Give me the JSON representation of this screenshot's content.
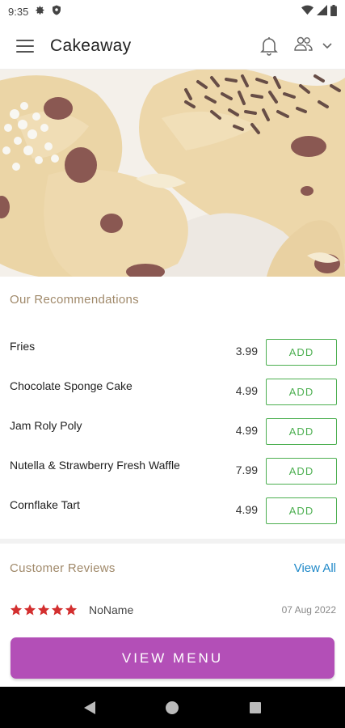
{
  "status_bar": {
    "time": "9:35"
  },
  "app_bar": {
    "title": "Cakeaway"
  },
  "recommendations": {
    "title": "Our Recommendations",
    "add_label": "ADD",
    "items": [
      {
        "name": "Fries",
        "price": "3.99"
      },
      {
        "name": "Chocolate Sponge Cake",
        "price": "4.99"
      },
      {
        "name": "Jam Roly Poly",
        "price": "4.99"
      },
      {
        "name": "Nutella & Strawberry Fresh Waffle",
        "price": "7.99"
      },
      {
        "name": "Cornflake Tart",
        "price": "4.99"
      }
    ]
  },
  "reviews": {
    "title": "Customer Reviews",
    "view_all": "View All",
    "items": [
      {
        "rating": 5,
        "name": "NoName",
        "date": "07 Aug 2022"
      }
    ]
  },
  "view_menu_label": "VIEW MENU",
  "colors": {
    "accent": "#b34fb7",
    "add_green": "#4caf50",
    "section_title": "#a0896a",
    "link_blue": "#1e88c8",
    "star_red": "#d32f2f"
  },
  "icons": {
    "status": [
      "gear-icon",
      "shield-icon",
      "wifi-icon",
      "signal-icon",
      "battery-icon"
    ],
    "app_bar": [
      "menu-icon",
      "bell-icon",
      "users-icon",
      "chevron-down-icon"
    ],
    "nav": [
      "back-icon",
      "home-icon",
      "recents-icon"
    ]
  }
}
